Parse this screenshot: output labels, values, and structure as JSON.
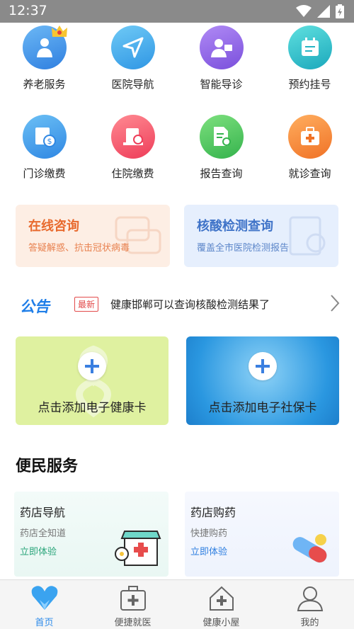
{
  "status_bar": {
    "time": "12:37"
  },
  "grid": [
    {
      "label": "养老服务",
      "icon": "elderly-icon",
      "color": "#3a8fe0"
    },
    {
      "label": "医院导航",
      "icon": "navigation-arrow-icon",
      "color": "#3ba7ec"
    },
    {
      "label": "智能导诊",
      "icon": "smart-triage-icon",
      "color": "#8a5fe0"
    },
    {
      "label": "预约挂号",
      "icon": "calendar-icon",
      "color": "#26b5c4"
    },
    {
      "label": "门诊缴费",
      "icon": "outpatient-payment-icon",
      "color": "#3a9ae8"
    },
    {
      "label": "住院缴费",
      "icon": "inpatient-payment-icon",
      "color": "#f2566a"
    },
    {
      "label": "报告查询",
      "icon": "report-search-icon",
      "color": "#4cc060"
    },
    {
      "label": "就诊查询",
      "icon": "medical-kit-icon",
      "color": "#f5803a"
    }
  ],
  "promos": {
    "online": {
      "title": "在线咨询",
      "subtitle": "答疑解惑、抗击冠状病毒"
    },
    "test": {
      "title": "核酸检测查询",
      "subtitle": "覆盖全市医院检测报告"
    }
  },
  "notice": {
    "brand": "公告",
    "badge": "最新",
    "text": "健康邯郸可以查询核酸检测结果了"
  },
  "cards": {
    "health": {
      "caption": "点击添加电子健康卡"
    },
    "social": {
      "caption": "点击添加电子社保卡"
    }
  },
  "section": {
    "title": "便民服务"
  },
  "services": {
    "pharmacy_nav": {
      "title": "药店导航",
      "subtitle": "药店全知道",
      "link": "立即体验"
    },
    "pharmacy_buy": {
      "title": "药店购药",
      "subtitle": "快捷购药",
      "link": "立即体验"
    }
  },
  "nav": [
    {
      "label": "首页",
      "icon": "home-heart-icon",
      "active": true
    },
    {
      "label": "便捷就医",
      "icon": "medical-kit-icon"
    },
    {
      "label": "健康小屋",
      "icon": "health-house-icon"
    },
    {
      "label": "我的",
      "icon": "user-icon"
    }
  ]
}
